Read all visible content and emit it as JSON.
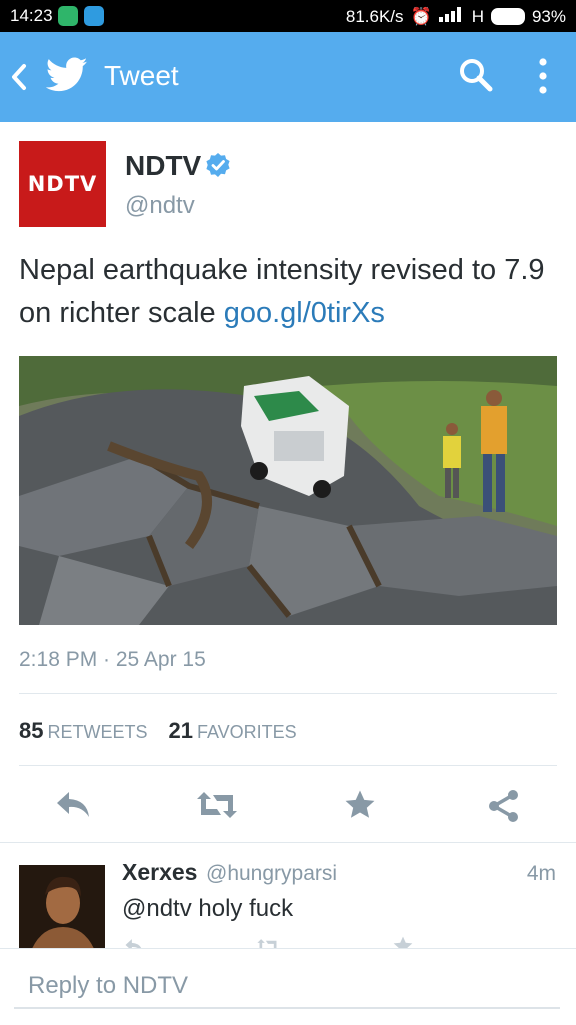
{
  "status_bar": {
    "time": "14:23",
    "network_speed": "81.6K/s",
    "network_type": "H",
    "battery": "93%"
  },
  "app_bar": {
    "title": "Tweet",
    "back_icon": "chevron-left-icon",
    "logo_icon": "twitter-bird-icon",
    "search_icon": "search-icon",
    "more_icon": "more-vertical-icon",
    "background": "#55acee"
  },
  "tweet": {
    "author_name": "NDTV",
    "author_handle": "@ndtv",
    "avatar_text": "NDTV",
    "text": "Nepal earthquake intensity revised to 7.9 on richter scale",
    "link": "goo.gl/0tirXs",
    "timestamp": "2:18 PM · 25 Apr 15",
    "retweets_count": "85",
    "retweets_label": "RETWEETS",
    "favorites_count": "21",
    "favorites_label": "FAVORITES"
  },
  "actions": [
    "reply-icon",
    "retweet-icon",
    "favorite-icon",
    "share-icon"
  ],
  "reply": {
    "name": "Xerxes",
    "handle": "@hungryparsi",
    "time": "4m",
    "text": "@ndtv holy fuck"
  },
  "compose": {
    "placeholder": "Reply to NDTV"
  },
  "colors": {
    "brand": "#55acee",
    "link": "#2b7bb9",
    "ndtv_red": "#c81a1a",
    "muted_text": "#8899a6"
  }
}
